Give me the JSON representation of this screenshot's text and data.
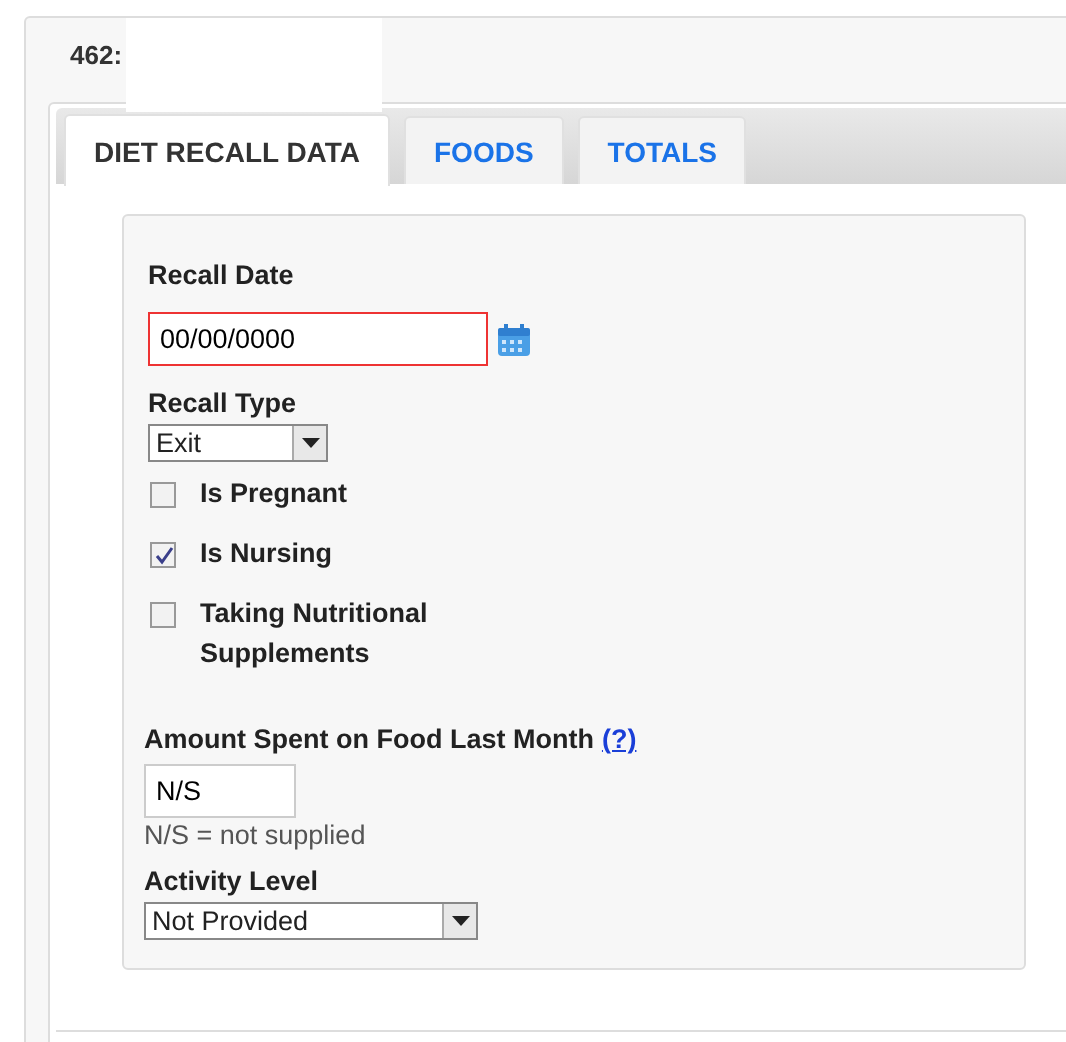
{
  "header": {
    "title": "462:"
  },
  "tabs": [
    {
      "label": "DIET RECALL DATA",
      "selected": true
    },
    {
      "label": "FOODS",
      "selected": false
    },
    {
      "label": "TOTALS",
      "selected": false
    }
  ],
  "recall_date": {
    "label": "Recall Date",
    "value": "00/00/0000",
    "invalid": true
  },
  "recall_type": {
    "label": "Recall Type",
    "value": "Exit"
  },
  "checkboxes": [
    {
      "label": "Is Pregnant",
      "checked": false
    },
    {
      "label": "Is Nursing",
      "checked": true
    },
    {
      "label": "Taking Nutritional Supplements",
      "checked": false
    }
  ],
  "amount_spent": {
    "label": "Amount Spent on Food Last Month",
    "help_link": "(?)",
    "value": "N/S",
    "hint": "N/S = not supplied"
  },
  "activity_level": {
    "label": "Activity Level",
    "value": "Not Provided"
  }
}
